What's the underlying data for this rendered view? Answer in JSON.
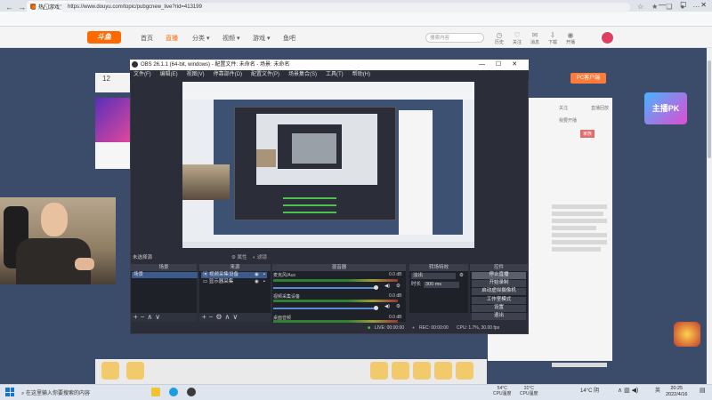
{
  "browser": {
    "tab_title": "热门游戏直播平台直播",
    "new_tab": "+",
    "url": "https://www.douyu.com/topic/pubgcnew_live?rid=413199",
    "window_controls": [
      "—",
      "☐",
      "✕"
    ],
    "nav_back": "←",
    "nav_forward": "→",
    "nav_reload": "C",
    "nav_home": "⌂"
  },
  "douyu": {
    "logo": "斗鱼",
    "nav": [
      "首页",
      "直播",
      "分类 ▾",
      "视频 ▾",
      "游戏 ▾",
      "鱼吧"
    ],
    "search_placeholder": "搜索内容",
    "top_icons": [
      {
        "icon": "history-icon",
        "label": "历史"
      },
      {
        "icon": "follow-icon",
        "label": "关注"
      },
      {
        "icon": "message-icon",
        "label": "消息"
      },
      {
        "icon": "upload-icon",
        "label": "下载"
      },
      {
        "icon": "broadcast-icon",
        "label": "开播"
      }
    ],
    "count": "12",
    "pc_button": "PC客户端",
    "right_texts": [
      "关注",
      "直播回放",
      "我要开播",
      "家族"
    ],
    "pk_label": "主播PK"
  },
  "obs": {
    "title": "OBS 26.1.1 (64-bit, windows) - 配置文件: 未命名 - 场景: 未命名",
    "menu": [
      "文件(F)",
      "编辑(E)",
      "视图(V)",
      "停靠部件(D)",
      "配置文件(P)",
      "场景集合(S)",
      "工具(T)",
      "帮助(H)"
    ],
    "source_label": "未选择源",
    "props_button": "属性",
    "filters_button": "滤镜",
    "docks": {
      "scenes": "场景",
      "sources": "来源",
      "mixer": "混音器",
      "transitions": "转场特效",
      "controls": "控件"
    },
    "scenes": [
      "场景"
    ],
    "sources": [
      "视频采集设备",
      "显示器采集"
    ],
    "mixer": [
      {
        "name": "麦克风/Aux",
        "value": "0.0 dB"
      },
      {
        "name": "视频采集设备",
        "value": "0.0 dB"
      },
      {
        "name": "桌面音频",
        "value": "0.0 dB"
      }
    ],
    "transition": {
      "type": "淡出",
      "duration_label": "时长",
      "duration": "300 ms"
    },
    "controls": [
      "停止直播",
      "开始录制",
      "启动虚拟摄像机",
      "工作室模式",
      "设置",
      "退出"
    ],
    "status": {
      "live": "LIVE: 00:00:00",
      "rec": "REC: 00:00:00",
      "cpu": "CPU: 1.7%, 30.00 fps"
    }
  },
  "taskbar": {
    "search_text": "在这里输入你要搜索的内容",
    "cpu_temp1": "54°C",
    "cpu_label1": "CPU温度",
    "cpu_temp2": "31°C",
    "cpu_label2": "CPU温度",
    "weather": "14°C 阴",
    "lang": "英",
    "time": "20:25",
    "date": "2022/4/16"
  },
  "colors": {
    "douyu_orange": "#ff6a00",
    "obs_bg": "#2b2e38",
    "meter_green": "#35a035"
  }
}
